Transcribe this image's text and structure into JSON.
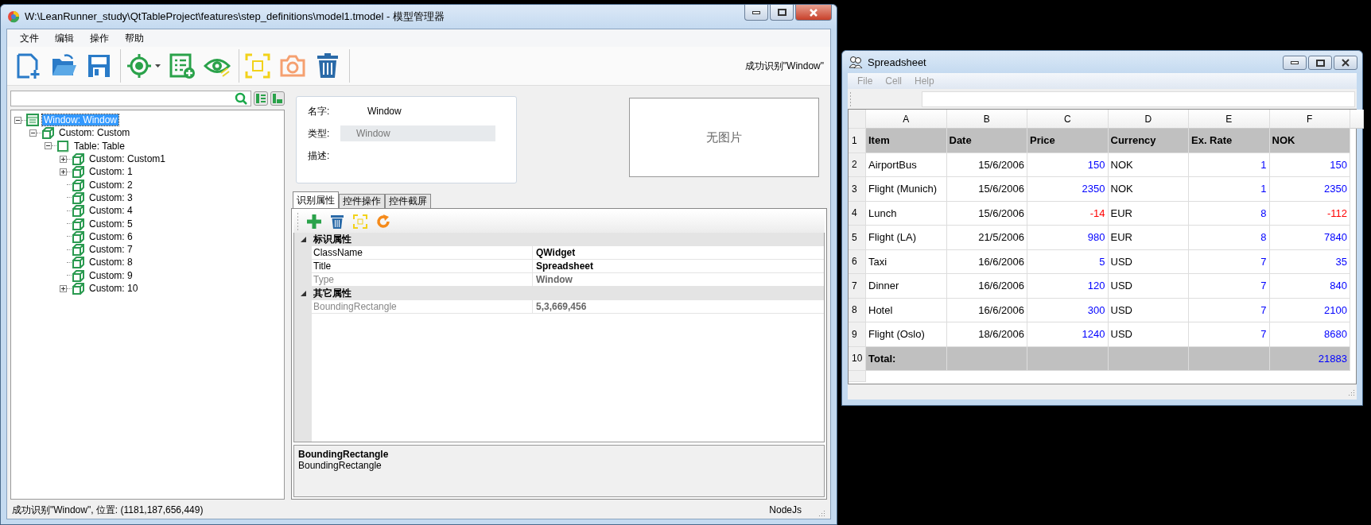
{
  "main_window": {
    "title": "W:\\LeanRunner_study\\QtTableProject\\features\\step_definitions\\model1.tmodel - 模型管理器",
    "menu": [
      "文件",
      "编辑",
      "操作",
      "帮助"
    ],
    "toolbar_status": "成功识别\"Window\"",
    "tree": [
      {
        "label": "Window: Window",
        "kind": "window",
        "selected": true,
        "expanded": true,
        "children": [
          {
            "label": "Custom: Custom",
            "kind": "custom",
            "selected": false,
            "expanded": true,
            "children": [
              {
                "label": "Table: Table",
                "kind": "table",
                "selected": false,
                "expanded": true,
                "children": [
                  {
                    "label": "Custom: Custom1",
                    "kind": "custom",
                    "selected": false,
                    "expanded": false
                  },
                  {
                    "label": "Custom: 1",
                    "kind": "custom",
                    "selected": false,
                    "expanded": false
                  },
                  {
                    "label": "Custom: 2",
                    "kind": "custom",
                    "selected": false
                  },
                  {
                    "label": "Custom: 3",
                    "kind": "custom",
                    "selected": false
                  },
                  {
                    "label": "Custom: 4",
                    "kind": "custom",
                    "selected": false
                  },
                  {
                    "label": "Custom: 5",
                    "kind": "custom",
                    "selected": false
                  },
                  {
                    "label": "Custom: 6",
                    "kind": "custom",
                    "selected": false
                  },
                  {
                    "label": "Custom: 7",
                    "kind": "custom",
                    "selected": false
                  },
                  {
                    "label": "Custom: 8",
                    "kind": "custom",
                    "selected": false
                  },
                  {
                    "label": "Custom: 9",
                    "kind": "custom",
                    "selected": false
                  },
                  {
                    "label": "Custom: 10",
                    "kind": "custom",
                    "selected": false,
                    "expanded": false
                  }
                ]
              }
            ]
          }
        ]
      }
    ],
    "details": [
      {
        "label": "名字:",
        "value": "Window",
        "kind": "plain"
      },
      {
        "label": "类型:",
        "value": "Window",
        "kind": "readonly"
      },
      {
        "label": "描述:",
        "kind": "plain"
      }
    ],
    "preview": {
      "text": "无图片"
    },
    "tabs": [
      {
        "label": "识别属性",
        "selected": true
      },
      {
        "label": "控件操作",
        "selected": false
      },
      {
        "label": "控件截屏",
        "selected": false
      }
    ],
    "property_groups": [
      {
        "title": "标识属性",
        "expanded": true,
        "rows": [
          {
            "name": "ClassName",
            "value": "QWidget",
            "enabled": true
          },
          {
            "name": "Title",
            "value": "Spreadsheet",
            "enabled": true
          },
          {
            "name": "Type",
            "value": "Window",
            "enabled": false
          }
        ]
      },
      {
        "title": "其它属性",
        "expanded": true,
        "rows": [
          {
            "name": "BoundingRectangle",
            "value": "5,3,669,456",
            "enabled": false
          }
        ]
      }
    ],
    "help": {
      "title": "BoundingRectangle",
      "text": "BoundingRectangle"
    },
    "status_bar": {
      "message": "成功识别\"Window\", 位置: (1181,187,656,449)",
      "mode": "NodeJs"
    }
  },
  "spreadsheet": {
    "title": "Spreadsheet",
    "menu": [
      "File",
      "Cell",
      "Help"
    ],
    "columns": [
      "A",
      "B",
      "C",
      "D",
      "E",
      "F"
    ],
    "rows": [
      {
        "header": "1",
        "kind": "heading",
        "cells": [
          {
            "text": "Item",
            "kind": "text"
          },
          {
            "text": "Date",
            "kind": "text"
          },
          {
            "text": "Price",
            "kind": "text"
          },
          {
            "text": "Currency",
            "kind": "text"
          },
          {
            "text": "Ex. Rate",
            "kind": "text"
          },
          {
            "text": "NOK",
            "kind": "text"
          }
        ]
      },
      {
        "header": "2",
        "kind": "data",
        "cells": [
          {
            "text": "AirportBus",
            "kind": "text"
          },
          {
            "text": "15/6/2006",
            "kind": "number"
          },
          {
            "text": "150",
            "kind": "number",
            "color": "#0000ff"
          },
          {
            "text": "NOK",
            "kind": "text"
          },
          {
            "text": "1",
            "kind": "number",
            "color": "#0000ff"
          },
          {
            "text": "150",
            "kind": "number",
            "color": "#0000ff"
          }
        ]
      },
      {
        "header": "3",
        "kind": "data",
        "cells": [
          {
            "text": "Flight (Munich)",
            "kind": "text"
          },
          {
            "text": "15/6/2006",
            "kind": "number"
          },
          {
            "text": "2350",
            "kind": "number",
            "color": "#0000ff"
          },
          {
            "text": "NOK",
            "kind": "text"
          },
          {
            "text": "1",
            "kind": "number",
            "color": "#0000ff"
          },
          {
            "text": "2350",
            "kind": "number",
            "color": "#0000ff"
          }
        ]
      },
      {
        "header": "4",
        "kind": "data",
        "cells": [
          {
            "text": "Lunch",
            "kind": "text"
          },
          {
            "text": "15/6/2006",
            "kind": "number"
          },
          {
            "text": "-14",
            "kind": "number",
            "color": "#ff0000"
          },
          {
            "text": "EUR",
            "kind": "text"
          },
          {
            "text": "8",
            "kind": "number",
            "color": "#0000ff"
          },
          {
            "text": "-112",
            "kind": "number",
            "color": "#ff0000"
          }
        ]
      },
      {
        "header": "5",
        "kind": "data",
        "cells": [
          {
            "text": "Flight (LA)",
            "kind": "text"
          },
          {
            "text": "21/5/2006",
            "kind": "number"
          },
          {
            "text": "980",
            "kind": "number",
            "color": "#0000ff"
          },
          {
            "text": "EUR",
            "kind": "text"
          },
          {
            "text": "8",
            "kind": "number",
            "color": "#0000ff"
          },
          {
            "text": "7840",
            "kind": "number",
            "color": "#0000ff"
          }
        ]
      },
      {
        "header": "6",
        "kind": "data",
        "cells": [
          {
            "text": "Taxi",
            "kind": "text"
          },
          {
            "text": "16/6/2006",
            "kind": "number"
          },
          {
            "text": "5",
            "kind": "number",
            "color": "#0000ff"
          },
          {
            "text": "USD",
            "kind": "text"
          },
          {
            "text": "7",
            "kind": "number",
            "color": "#0000ff"
          },
          {
            "text": "35",
            "kind": "number",
            "color": "#0000ff"
          }
        ]
      },
      {
        "header": "7",
        "kind": "data",
        "cells": [
          {
            "text": "Dinner",
            "kind": "text"
          },
          {
            "text": "16/6/2006",
            "kind": "number"
          },
          {
            "text": "120",
            "kind": "number",
            "color": "#0000ff"
          },
          {
            "text": "USD",
            "kind": "text"
          },
          {
            "text": "7",
            "kind": "number",
            "color": "#0000ff"
          },
          {
            "text": "840",
            "kind": "number",
            "color": "#0000ff"
          }
        ]
      },
      {
        "header": "8",
        "kind": "data",
        "cells": [
          {
            "text": "Hotel",
            "kind": "text"
          },
          {
            "text": "16/6/2006",
            "kind": "number"
          },
          {
            "text": "300",
            "kind": "number",
            "color": "#0000ff"
          },
          {
            "text": "USD",
            "kind": "text"
          },
          {
            "text": "7",
            "kind": "number",
            "color": "#0000ff"
          },
          {
            "text": "2100",
            "kind": "number",
            "color": "#0000ff"
          }
        ]
      },
      {
        "header": "9",
        "kind": "data",
        "cells": [
          {
            "text": "Flight (Oslo)",
            "kind": "text"
          },
          {
            "text": "18/6/2006",
            "kind": "number"
          },
          {
            "text": "1240",
            "kind": "number",
            "color": "#0000ff"
          },
          {
            "text": "USD",
            "kind": "text"
          },
          {
            "text": "7",
            "kind": "number",
            "color": "#0000ff"
          },
          {
            "text": "8680",
            "kind": "number",
            "color": "#0000ff"
          }
        ]
      },
      {
        "header": "10",
        "kind": "total",
        "cells": [
          {
            "text": "Total:",
            "kind": "text"
          },
          {
            "kind": "empty"
          },
          {
            "kind": "empty"
          },
          {
            "kind": "empty"
          },
          {
            "kind": "empty"
          },
          {
            "text": "21883",
            "kind": "number",
            "color": "#0000ff"
          }
        ]
      }
    ]
  }
}
